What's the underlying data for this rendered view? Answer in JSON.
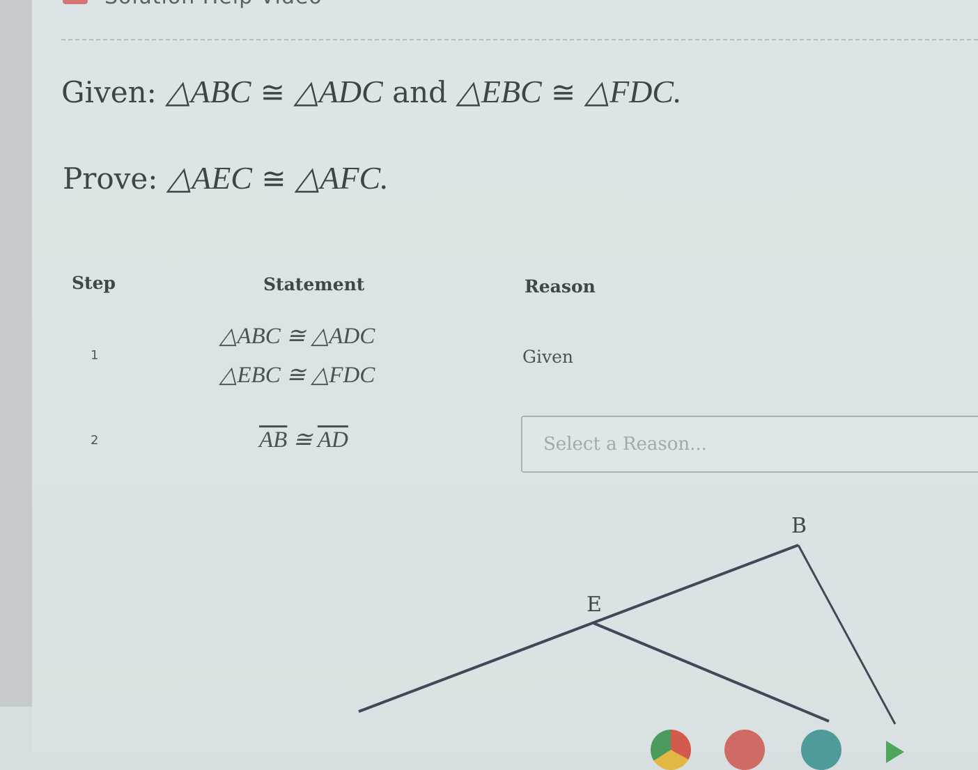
{
  "header": {
    "title": "Solution Help Video"
  },
  "problem": {
    "given_label": "Given:",
    "given_parts": [
      "△ABC",
      "≅",
      "△ADC",
      "and",
      "△EBC",
      "≅",
      "△FDC."
    ],
    "prove_label": "Prove:",
    "prove_parts": [
      "△AEC",
      "≅",
      "△AFC."
    ]
  },
  "table": {
    "headers": {
      "step": "Step",
      "statement": "Statement",
      "reason": "Reason"
    },
    "rows": [
      {
        "step": "1",
        "statements": [
          "△ABC ≅ △ADC",
          "△EBC ≅ △FDC"
        ],
        "reason": "Given"
      },
      {
        "step": "2",
        "statement_left": "AB",
        "statement_symbol": " ≅ ",
        "statement_right": "AD",
        "reason_placeholder": "Select a Reason..."
      }
    ]
  },
  "diagram": {
    "labels": {
      "b": "B",
      "e": "E"
    }
  }
}
